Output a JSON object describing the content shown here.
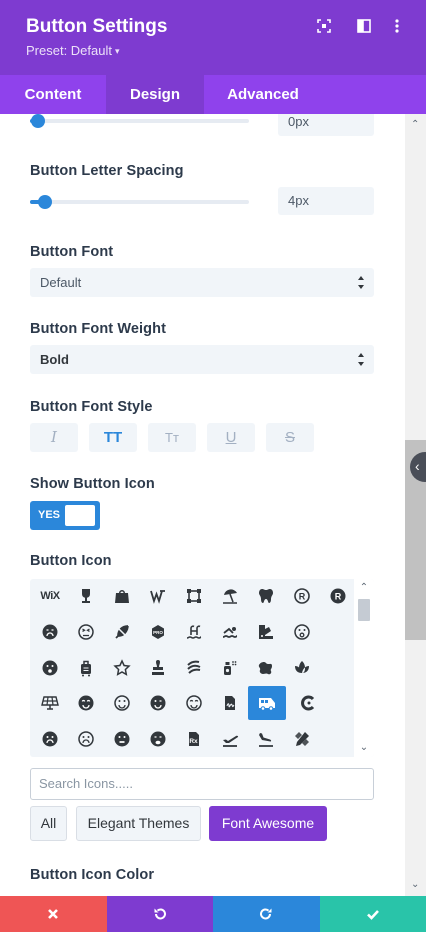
{
  "header": {
    "title": "Button Settings",
    "preset_label": "Preset: Default",
    "preset_caret": "▾",
    "icons": [
      "expand-icon",
      "sidebar-layout-icon",
      "more-vertical-icon"
    ]
  },
  "tabs": [
    {
      "label": "Content",
      "active": false
    },
    {
      "label": "Design",
      "active": true
    },
    {
      "label": "Advanced",
      "active": false
    }
  ],
  "settings": {
    "prev_slider": {
      "value_text": "0px",
      "fraction": 0.0
    },
    "letter_spacing": {
      "label": "Button Letter Spacing",
      "value_text": "4px",
      "fraction": 0.06
    },
    "font": {
      "label": "Button Font",
      "value": "Default"
    },
    "font_weight": {
      "label": "Button Font Weight",
      "value": "Bold"
    },
    "font_style": {
      "label": "Button Font Style",
      "options": [
        {
          "name": "italic",
          "glyph": "I",
          "active": false
        },
        {
          "name": "uppercase",
          "glyph": "TT",
          "active": true
        },
        {
          "name": "small-caps",
          "glyph": "Tт",
          "active": false
        },
        {
          "name": "underline",
          "glyph": "U",
          "active": false
        },
        {
          "name": "strikethrough",
          "glyph": "S",
          "active": false
        }
      ]
    },
    "show_icon": {
      "label": "Show Button Icon",
      "toggle_text": "YES",
      "on": true
    },
    "button_icon": {
      "label": "Button Icon",
      "icons": [
        [
          "wix-icon",
          "wine-bottle-icon",
          "bag-icon",
          "wordpress-icon",
          "vector-square-icon",
          "umbrella-beach-icon",
          "tooth-icon",
          "registered-icon",
          "registered-solid-icon"
        ],
        [
          "sad-cry-icon",
          "tired-face-icon",
          "feather-icon",
          "pro-badge-icon",
          "swimming-pool-icon",
          "swimmer-icon",
          "swatchbook-icon",
          "surprise-icon"
        ],
        [
          "surprise-solid-icon",
          "suitcase-rolling-icon",
          "star-outline-icon",
          "stamp-icon",
          "stack-exchange-icon",
          "spray-can-icon",
          "splotch-icon",
          "spa-icon"
        ],
        [
          "solar-panel-icon",
          "smile-beam-icon",
          "smile-icon",
          "smile-wink-icon",
          "smile-outline-icon",
          "signature-icon",
          "shuttle-van-icon",
          "shipping-icon"
        ],
        [
          "sad-icon",
          "sad-outline-icon",
          "sad-tear-icon",
          "sad-cry-solid-icon",
          "prescription-icon",
          "plane-departure-icon",
          "plane-arrival-icon",
          "pencil-ruler-icon"
        ]
      ],
      "selected": "shuttle-van-icon"
    },
    "search": {
      "placeholder": "Search Icons....."
    },
    "filters": [
      {
        "label": "All",
        "active": false
      },
      {
        "label": "Elegant Themes",
        "active": false
      },
      {
        "label": "Font Awesome",
        "active": true
      }
    ],
    "icon_color": {
      "label": "Button Icon Color"
    }
  },
  "footer": {
    "buttons": [
      {
        "name": "cancel",
        "color": "#ef5555"
      },
      {
        "name": "undo",
        "color": "#7e3bd0"
      },
      {
        "name": "redo",
        "color": "#2b87da"
      },
      {
        "name": "save",
        "color": "#29c4a9"
      }
    ]
  },
  "colors": {
    "header": "#7e3bd0",
    "tabs": "#8f42ec",
    "accent": "#2b87da"
  }
}
